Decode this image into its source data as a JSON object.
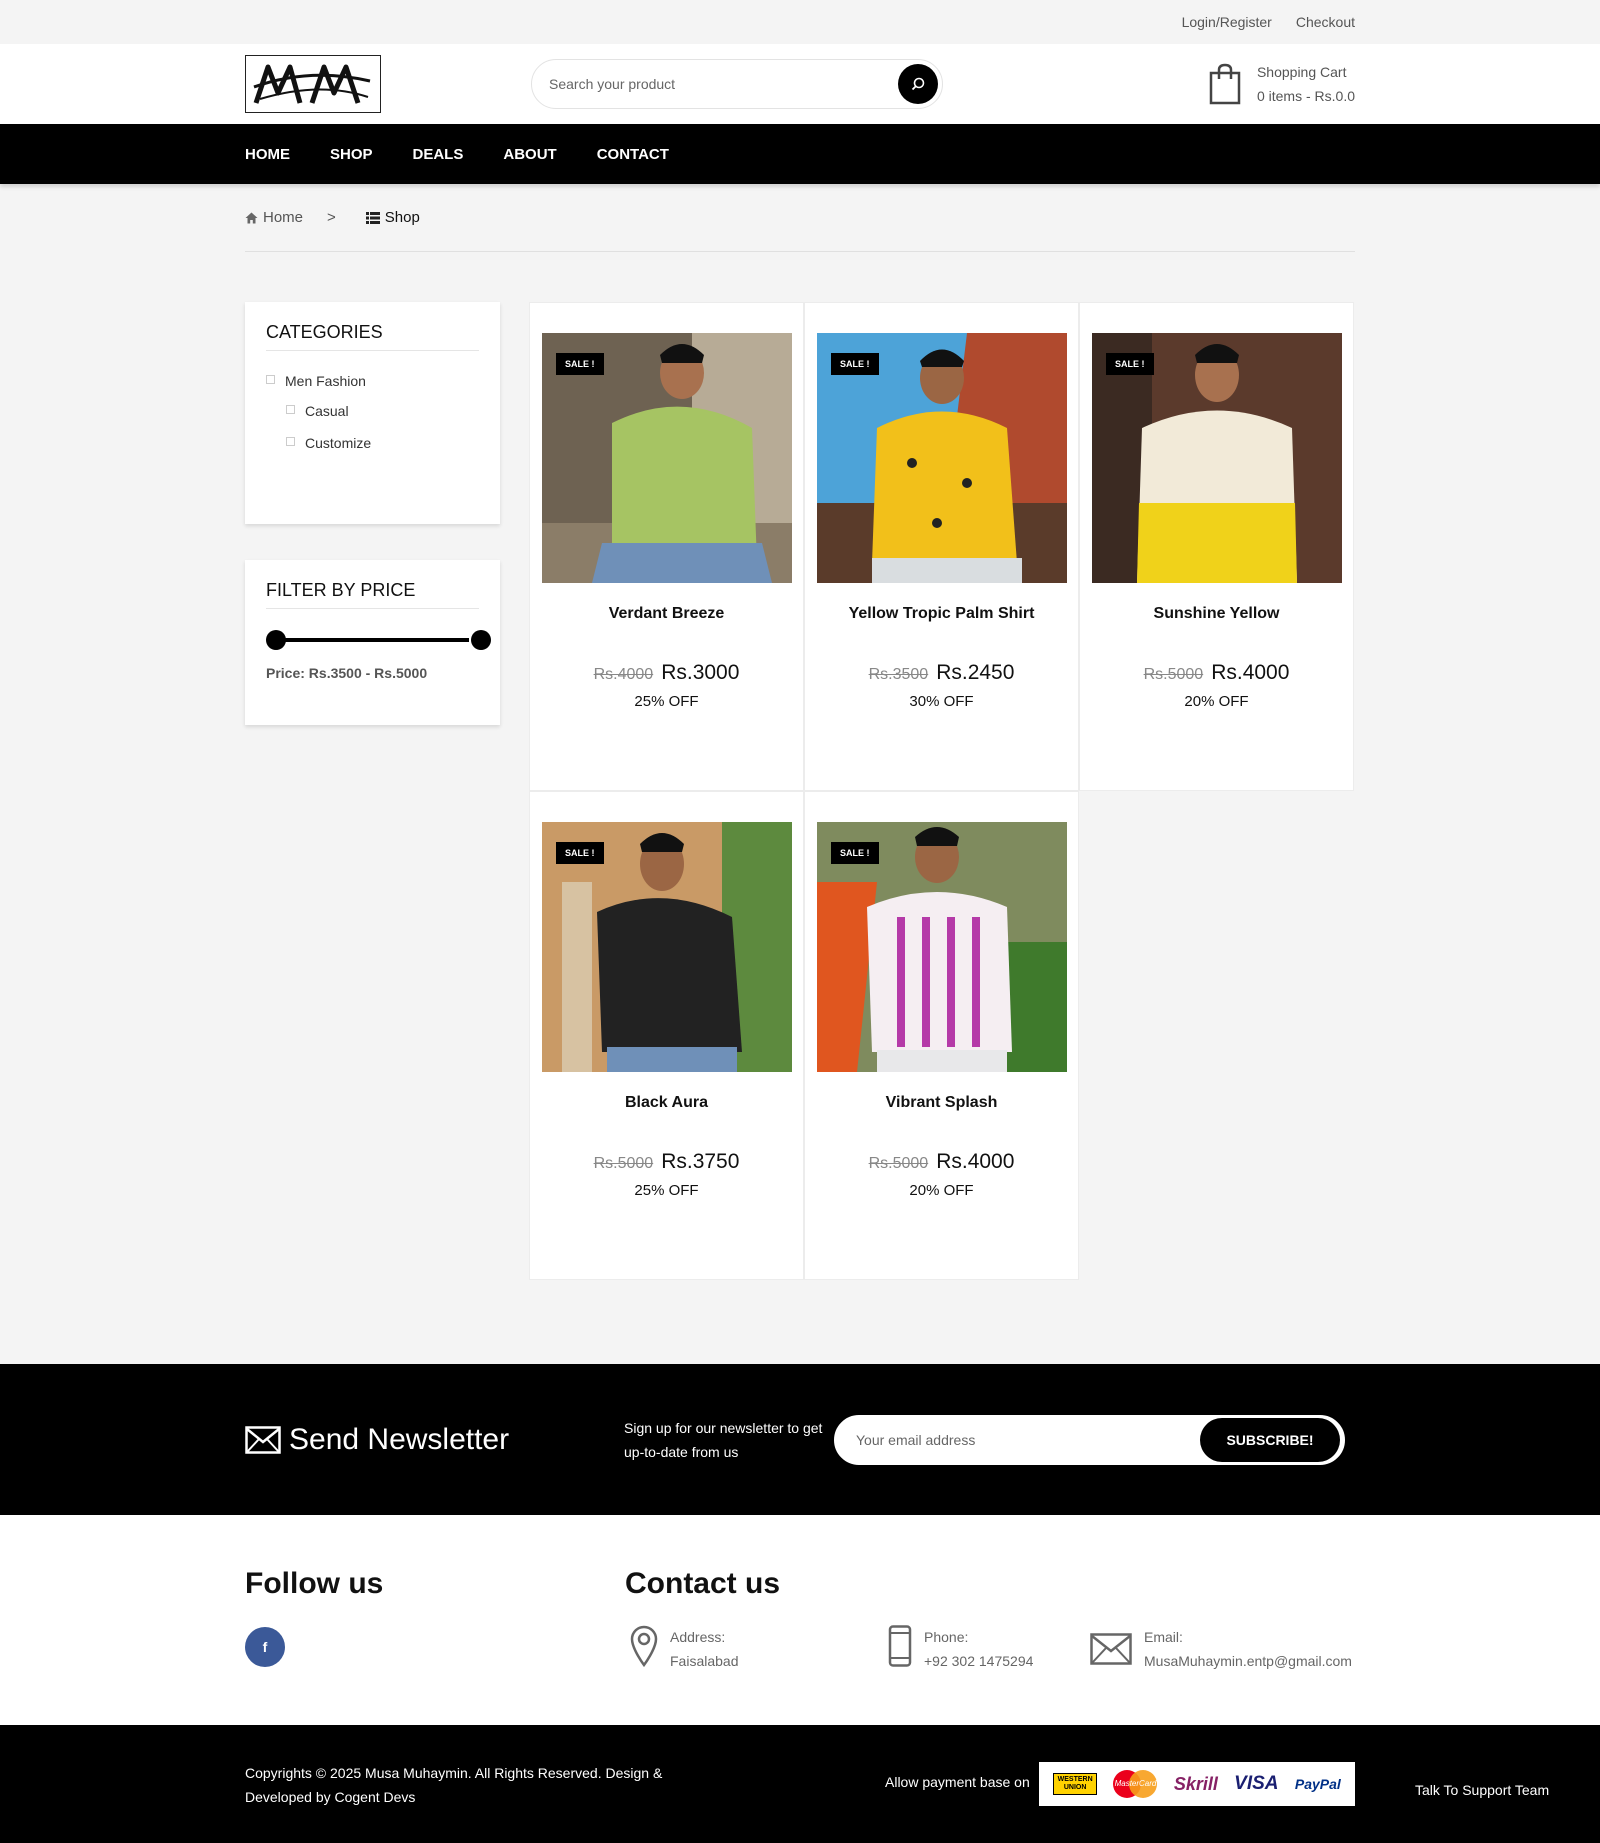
{
  "topbar": {
    "login": "Login/Register",
    "checkout": "Checkout"
  },
  "header": {
    "search_placeholder": "Search your product",
    "cart_title": "Shopping Cart",
    "cart_summary": "0 items - Rs.0.0"
  },
  "nav": [
    "HOME",
    "SHOP",
    "DEALS",
    "ABOUT",
    "CONTACT"
  ],
  "breadcrumb": {
    "home": "Home",
    "separator": ">",
    "current": "Shop"
  },
  "sidebar": {
    "categories_title": "CATEGORIES",
    "categories": [
      {
        "label": "Men Fashion",
        "level": 0
      },
      {
        "label": "Casual",
        "level": 1
      },
      {
        "label": "Customize",
        "level": 1
      }
    ],
    "filter_title": "FILTER BY PRICE",
    "price_range": "Price: Rs.3500 - Rs.5000"
  },
  "products": [
    {
      "badge": "SALE !",
      "name": "Verdant Breeze",
      "old_price": "Rs.4000",
      "price": "Rs.3000",
      "discount": "25% OFF"
    },
    {
      "badge": "SALE !",
      "name": "Yellow Tropic Palm Shirt",
      "old_price": "Rs.3500",
      "price": "Rs.2450",
      "discount": "30% OFF"
    },
    {
      "badge": "SALE !",
      "name": "Sunshine Yellow",
      "old_price": "Rs.5000",
      "price": "Rs.4000",
      "discount": "20% OFF"
    },
    {
      "badge": "SALE !",
      "name": "Black Aura",
      "old_price": "Rs.5000",
      "price": "Rs.3750",
      "discount": "25% OFF"
    },
    {
      "badge": "SALE !",
      "name": "Vibrant Splash",
      "old_price": "Rs.5000",
      "price": "Rs.4000",
      "discount": "20% OFF"
    }
  ],
  "newsletter": {
    "title": "Send Newsletter",
    "text": "Sign up for our newsletter to get up-to-date from us",
    "placeholder": "Your email address",
    "button": "SUBSCRIBE!"
  },
  "follow": {
    "title": "Follow us",
    "facebook": "f"
  },
  "contact": {
    "title": "Contact us",
    "address_label": "Address:",
    "address": "Faisalabad",
    "phone_label": "Phone:",
    "phone": "+92 302 1475294",
    "email_label": "Email:",
    "email": "MusaMuhaymin.entp@gmail.com"
  },
  "footer": {
    "copyright": "Copyrights © 2025 Musa Muhaymin. All Rights Reserved. Design & Developed by Cogent Devs",
    "payment_label": "Allow payment base on",
    "payment_methods": [
      "WESTERN UNION",
      "MasterCard",
      "Skrill",
      "VISA",
      "PayPal"
    ],
    "support": "Talk To Support Team"
  },
  "colors": {
    "primary": "#000000",
    "background": "#f4f4f4",
    "facebook": "#3b5998",
    "product_images": [
      "#a6c463",
      "#f2c01a",
      "#f2ead8",
      "#222222",
      "#b53aa8"
    ]
  }
}
